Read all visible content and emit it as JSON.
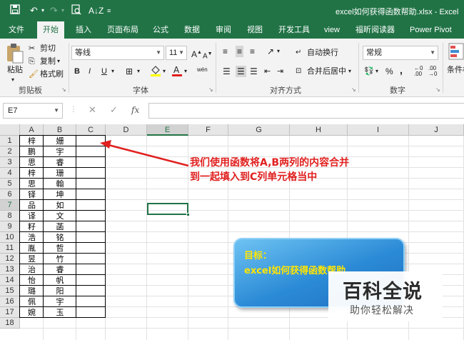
{
  "window": {
    "title": "excel如何获得函数帮助.xlsx - Excel",
    "save_icon": "save-icon",
    "undo_icon": "undo-icon",
    "redo_icon": "redo-icon",
    "print_preview_icon": "print-preview-icon",
    "sort_icon": "sort-icon",
    "customize_icon": "customize-qat-icon"
  },
  "tabs": [
    {
      "label": "文件"
    },
    {
      "label": "开始",
      "active": true
    },
    {
      "label": "插入"
    },
    {
      "label": "页面布局"
    },
    {
      "label": "公式"
    },
    {
      "label": "数据"
    },
    {
      "label": "审阅"
    },
    {
      "label": "视图"
    },
    {
      "label": "开发工具"
    },
    {
      "label": "view"
    },
    {
      "label": "福昕阅读器"
    },
    {
      "label": "Power Pivot"
    }
  ],
  "ribbon": {
    "clipboard": {
      "paste": "粘贴",
      "cut": "剪切",
      "copy": "复制",
      "format_painter": "格式刷",
      "group": "剪贴板"
    },
    "font": {
      "name": "等线",
      "size": "11",
      "bold": "B",
      "italic": "I",
      "underline": "U",
      "group": "字体",
      "phonetic": "wén"
    },
    "alignment": {
      "wrap": "自动换行",
      "merge": "合并后居中",
      "group": "对齐方式"
    },
    "number": {
      "format": "常规",
      "percent": "%",
      "comma": ",",
      "group": "数字"
    },
    "styles": {
      "conditional": "条件格"
    }
  },
  "formula_bar": {
    "name_box": "E7",
    "fx": "fx",
    "cancel": "✕",
    "enter": "✓",
    "formula": ""
  },
  "sheet": {
    "columns": [
      "A",
      "B",
      "C",
      "D",
      "E",
      "F",
      "G",
      "H",
      "I",
      "J"
    ],
    "selected_column": "E",
    "rows": [
      "1",
      "2",
      "3",
      "4",
      "5",
      "6",
      "7",
      "8",
      "9",
      "10",
      "11",
      "12",
      "13",
      "14",
      "15",
      "16",
      "17",
      "18"
    ],
    "selected_row": "7",
    "data": [
      [
        "梓",
        "姗"
      ],
      [
        "鹏",
        "宇"
      ],
      [
        "思",
        "睿"
      ],
      [
        "梓",
        "珊"
      ],
      [
        "思",
        "翰"
      ],
      [
        "铎",
        "坤"
      ],
      [
        "品",
        "如"
      ],
      [
        "译",
        "文"
      ],
      [
        "籽",
        "菡"
      ],
      [
        "浩",
        "铭"
      ],
      [
        "胤",
        "哲"
      ],
      [
        "昱",
        "竹"
      ],
      [
        "治",
        "睿"
      ],
      [
        "怡",
        "帆"
      ],
      [
        "璐",
        "阳"
      ],
      [
        "佩",
        "宇"
      ],
      [
        "婉",
        "玉"
      ]
    ]
  },
  "annotation": {
    "line1": "我们使用函数将A,B两列的内容合并",
    "line2": "到一起填入到C列单元格当中",
    "color": "#e0201f"
  },
  "goal_box": {
    "title": "目标：",
    "subtitle": "excel如何获得函数帮助"
  },
  "watermark": {
    "main": "百科全说",
    "sub": "助你轻松解决"
  },
  "colors": {
    "excel_green": "#217346",
    "annotation_red": "#e0201f",
    "goal_text": "#ffe500"
  }
}
